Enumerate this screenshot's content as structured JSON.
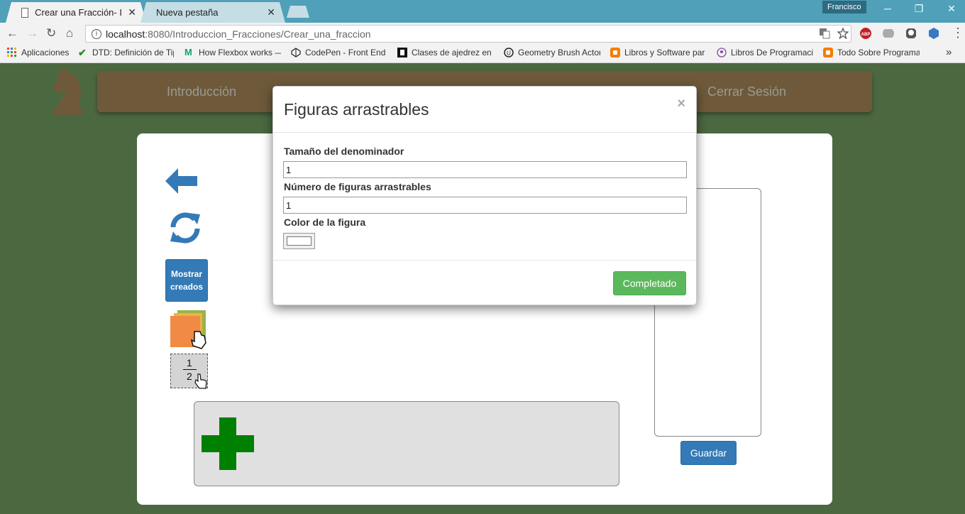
{
  "browser": {
    "tabs": [
      {
        "title": "Crear una Fracción- Intro",
        "active": true
      },
      {
        "title": "Nueva pestaña",
        "active": false
      }
    ],
    "close_glyph": "✕",
    "user": "Francisco",
    "window_controls": {
      "minimize": "─",
      "restore": "❐",
      "close": "✕"
    },
    "url_host": "localhost",
    "url_path": ":8080/Introduccion_Fracciones/Crear_una_fraccion",
    "nav": {
      "back": "←",
      "forward": "→",
      "reload": "↻",
      "home": "⌂"
    },
    "more_bookmarks": "»",
    "bookmarks": [
      {
        "label": "Aplicaciones",
        "icon": "apps-grid-icon",
        "color": "#e34b2e"
      },
      {
        "label": "DTD: Definición de Tip",
        "icon": "checkmark-icon",
        "color": "#2d8a2d"
      },
      {
        "label": "How Flexbox works —",
        "icon": "medium-m-icon",
        "color": "#11a36b"
      },
      {
        "label": "CodePen - Front End",
        "icon": "codepen-icon",
        "color": "#222222"
      },
      {
        "label": "Clases de ajedrez en",
        "icon": "chess-rook-icon",
        "color": "#111111"
      },
      {
        "label": "Geometry Brush Actor",
        "icon": "unreal-icon",
        "color": "#222222"
      },
      {
        "label": "Libros y Software par",
        "icon": "blogger-icon",
        "color": "#f57d00"
      },
      {
        "label": "Libros De Programaci",
        "icon": "podcast-icon",
        "color": "#8a4a9a"
      },
      {
        "label": "Todo Sobre Programa",
        "icon": "blogger-icon",
        "color": "#f57d00"
      }
    ]
  },
  "site_nav": {
    "intro": "Introducción",
    "logout": "Cerrar Sesión"
  },
  "toolbar": {
    "show_created_label": "Mostrar creados"
  },
  "fraction_tile": {
    "numerator": "1",
    "denominator": "2"
  },
  "sidebar": {
    "save_label": "Guardar"
  },
  "modal": {
    "title": "Figuras arrastrables",
    "close_glyph": "×",
    "denominator_label": "Tamaño del denominador",
    "denominator_value": "1",
    "figures_label": "Número de figuras arrastrables",
    "figures_value": "1",
    "color_label": "Color de la figura",
    "color_value": "#ffffff",
    "done_label": "Completado"
  },
  "colors": {
    "page_bg": "#4b6841",
    "nav_bg": "#6e5a3a",
    "primary": "#337ab7",
    "success": "#5cb85c",
    "plus_green": "#008000"
  }
}
